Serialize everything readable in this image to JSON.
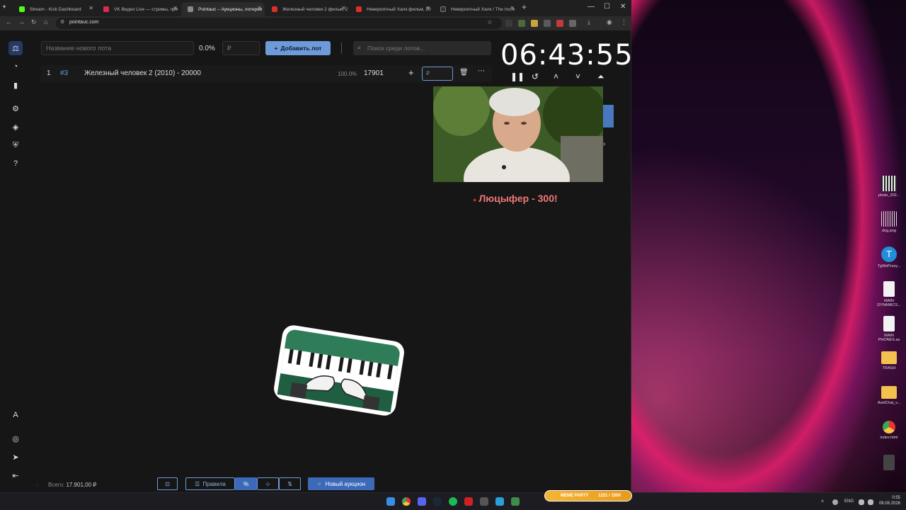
{
  "browser": {
    "tabs": [
      {
        "label": "Stream - Kick Dashboard",
        "color": "#53fc18"
      },
      {
        "label": "VK Видео Live — стримы, пря",
        "color": "#e0294d"
      },
      {
        "label": "Pointauc – Аукционы, лотереи",
        "color": "#888888",
        "active": true
      },
      {
        "label": "Железный человек 2 фильм, 2",
        "color": "#d8312b"
      },
      {
        "label": "Невероятный Халк фильм, 20",
        "color": "#d8312b"
      },
      {
        "label": "Невероятный Халк / The Incre",
        "color": "#333333"
      }
    ],
    "url": "pointauc.com"
  },
  "toolbar": {
    "new_lot_placeholder": "Название нового лота",
    "percent": "0.0%",
    "amount_placeholder": "₽",
    "add_lot_label": "Добавить лот",
    "search_placeholder": "Поиск среди лотов..."
  },
  "lots": [
    {
      "index": "1",
      "id": "#3",
      "name": "Железный человек 2 (2010) - 20000",
      "percent": "100.0%",
      "amount": "17901",
      "input_placeholder": "₽"
    }
  ],
  "timer": {
    "value": "06:43:55"
  },
  "donation": {
    "text": "Люцыфер - 300!"
  },
  "footer": {
    "total_label": "Всего:",
    "total_value": "17.901,00 ₽",
    "rules_label": "Правила",
    "new_auction_label": "Новый аукцион"
  },
  "desktop_icons": [
    {
      "label": "photo_202..."
    },
    {
      "label": "dog.png"
    },
    {
      "label": "TgWsProxy..."
    },
    {
      "label": "MAIN DYNAMICS..."
    },
    {
      "label": "MAIN PHONES.as"
    },
    {
      "label": "TRASH"
    },
    {
      "label": "AxelChat_v..."
    },
    {
      "label": "index.html"
    },
    {
      "label": ""
    }
  ],
  "taskbar": {
    "meme_party": "MEME PARTY",
    "meme_progress": "1221 / 1500",
    "language": "ENG",
    "time": "0:55",
    "date": "08.08.2026"
  }
}
